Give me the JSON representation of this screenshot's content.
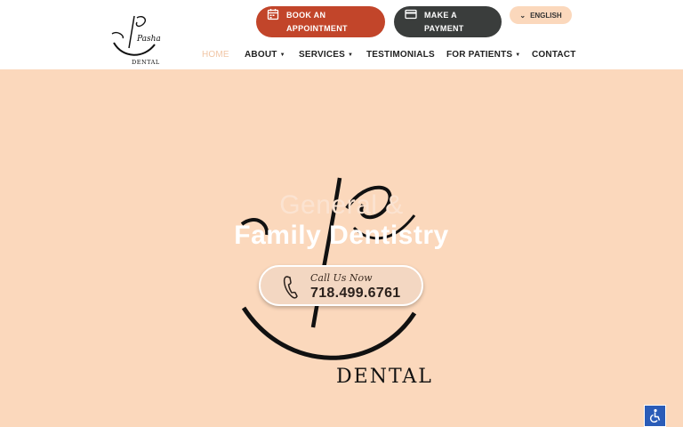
{
  "brand": {
    "logo_script": "Pasha",
    "logo_word": "DENTAL"
  },
  "header": {
    "book_button": {
      "line1": "BOOK AN",
      "line2": "APPOINTMENT",
      "icon": "calendar-icon"
    },
    "pay_button": {
      "line1": "MAKE A",
      "line2": "PAYMENT",
      "icon": "credit-card-icon"
    },
    "language": {
      "label": "ENGLISH",
      "icon": "chevron-down-icon"
    }
  },
  "nav": {
    "items": [
      {
        "label": "HOME",
        "active": true
      },
      {
        "label": "ABOUT",
        "dropdown": true
      },
      {
        "label": "SERVICES",
        "dropdown": true
      },
      {
        "label": "TESTIMONIALS"
      },
      {
        "label": "FOR PATIENTS",
        "dropdown": true
      },
      {
        "label": "CONTACT"
      }
    ]
  },
  "hero": {
    "line1": "General &",
    "line2": "Family Dentistry",
    "watermark_word": "DENTAL",
    "call": {
      "label": "Call Us Now",
      "number": "718.499.6761",
      "icon": "phone-icon"
    }
  },
  "accessibility": {
    "icon": "accessibility-icon"
  },
  "colors": {
    "book": "#c2452a",
    "pay": "#3a3d3c",
    "hero_bg": "#fbd8bc",
    "nav_active": "#f1c6a6",
    "access": "#2a5cb8"
  }
}
